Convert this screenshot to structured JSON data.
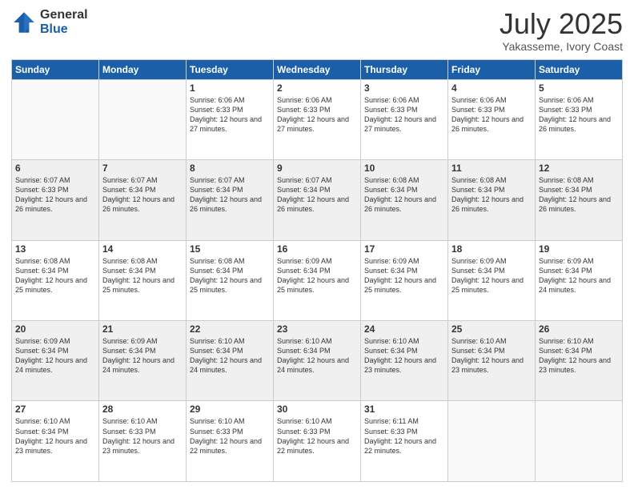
{
  "logo": {
    "general": "General",
    "blue": "Blue"
  },
  "header": {
    "title": "July 2025",
    "subtitle": "Yakasseme, Ivory Coast"
  },
  "weekdays": [
    "Sunday",
    "Monday",
    "Tuesday",
    "Wednesday",
    "Thursday",
    "Friday",
    "Saturday"
  ],
  "weeks": [
    [
      {
        "day": "",
        "info": ""
      },
      {
        "day": "",
        "info": ""
      },
      {
        "day": "1",
        "info": "Sunrise: 6:06 AM\nSunset: 6:33 PM\nDaylight: 12 hours and 27 minutes."
      },
      {
        "day": "2",
        "info": "Sunrise: 6:06 AM\nSunset: 6:33 PM\nDaylight: 12 hours and 27 minutes."
      },
      {
        "day": "3",
        "info": "Sunrise: 6:06 AM\nSunset: 6:33 PM\nDaylight: 12 hours and 27 minutes."
      },
      {
        "day": "4",
        "info": "Sunrise: 6:06 AM\nSunset: 6:33 PM\nDaylight: 12 hours and 26 minutes."
      },
      {
        "day": "5",
        "info": "Sunrise: 6:06 AM\nSunset: 6:33 PM\nDaylight: 12 hours and 26 minutes."
      }
    ],
    [
      {
        "day": "6",
        "info": "Sunrise: 6:07 AM\nSunset: 6:33 PM\nDaylight: 12 hours and 26 minutes."
      },
      {
        "day": "7",
        "info": "Sunrise: 6:07 AM\nSunset: 6:34 PM\nDaylight: 12 hours and 26 minutes."
      },
      {
        "day": "8",
        "info": "Sunrise: 6:07 AM\nSunset: 6:34 PM\nDaylight: 12 hours and 26 minutes."
      },
      {
        "day": "9",
        "info": "Sunrise: 6:07 AM\nSunset: 6:34 PM\nDaylight: 12 hours and 26 minutes."
      },
      {
        "day": "10",
        "info": "Sunrise: 6:08 AM\nSunset: 6:34 PM\nDaylight: 12 hours and 26 minutes."
      },
      {
        "day": "11",
        "info": "Sunrise: 6:08 AM\nSunset: 6:34 PM\nDaylight: 12 hours and 26 minutes."
      },
      {
        "day": "12",
        "info": "Sunrise: 6:08 AM\nSunset: 6:34 PM\nDaylight: 12 hours and 26 minutes."
      }
    ],
    [
      {
        "day": "13",
        "info": "Sunrise: 6:08 AM\nSunset: 6:34 PM\nDaylight: 12 hours and 25 minutes."
      },
      {
        "day": "14",
        "info": "Sunrise: 6:08 AM\nSunset: 6:34 PM\nDaylight: 12 hours and 25 minutes."
      },
      {
        "day": "15",
        "info": "Sunrise: 6:08 AM\nSunset: 6:34 PM\nDaylight: 12 hours and 25 minutes."
      },
      {
        "day": "16",
        "info": "Sunrise: 6:09 AM\nSunset: 6:34 PM\nDaylight: 12 hours and 25 minutes."
      },
      {
        "day": "17",
        "info": "Sunrise: 6:09 AM\nSunset: 6:34 PM\nDaylight: 12 hours and 25 minutes."
      },
      {
        "day": "18",
        "info": "Sunrise: 6:09 AM\nSunset: 6:34 PM\nDaylight: 12 hours and 25 minutes."
      },
      {
        "day": "19",
        "info": "Sunrise: 6:09 AM\nSunset: 6:34 PM\nDaylight: 12 hours and 24 minutes."
      }
    ],
    [
      {
        "day": "20",
        "info": "Sunrise: 6:09 AM\nSunset: 6:34 PM\nDaylight: 12 hours and 24 minutes."
      },
      {
        "day": "21",
        "info": "Sunrise: 6:09 AM\nSunset: 6:34 PM\nDaylight: 12 hours and 24 minutes."
      },
      {
        "day": "22",
        "info": "Sunrise: 6:10 AM\nSunset: 6:34 PM\nDaylight: 12 hours and 24 minutes."
      },
      {
        "day": "23",
        "info": "Sunrise: 6:10 AM\nSunset: 6:34 PM\nDaylight: 12 hours and 24 minutes."
      },
      {
        "day": "24",
        "info": "Sunrise: 6:10 AM\nSunset: 6:34 PM\nDaylight: 12 hours and 23 minutes."
      },
      {
        "day": "25",
        "info": "Sunrise: 6:10 AM\nSunset: 6:34 PM\nDaylight: 12 hours and 23 minutes."
      },
      {
        "day": "26",
        "info": "Sunrise: 6:10 AM\nSunset: 6:34 PM\nDaylight: 12 hours and 23 minutes."
      }
    ],
    [
      {
        "day": "27",
        "info": "Sunrise: 6:10 AM\nSunset: 6:34 PM\nDaylight: 12 hours and 23 minutes."
      },
      {
        "day": "28",
        "info": "Sunrise: 6:10 AM\nSunset: 6:33 PM\nDaylight: 12 hours and 23 minutes."
      },
      {
        "day": "29",
        "info": "Sunrise: 6:10 AM\nSunset: 6:33 PM\nDaylight: 12 hours and 22 minutes."
      },
      {
        "day": "30",
        "info": "Sunrise: 6:10 AM\nSunset: 6:33 PM\nDaylight: 12 hours and 22 minutes."
      },
      {
        "day": "31",
        "info": "Sunrise: 6:11 AM\nSunset: 6:33 PM\nDaylight: 12 hours and 22 minutes."
      },
      {
        "day": "",
        "info": ""
      },
      {
        "day": "",
        "info": ""
      }
    ]
  ]
}
